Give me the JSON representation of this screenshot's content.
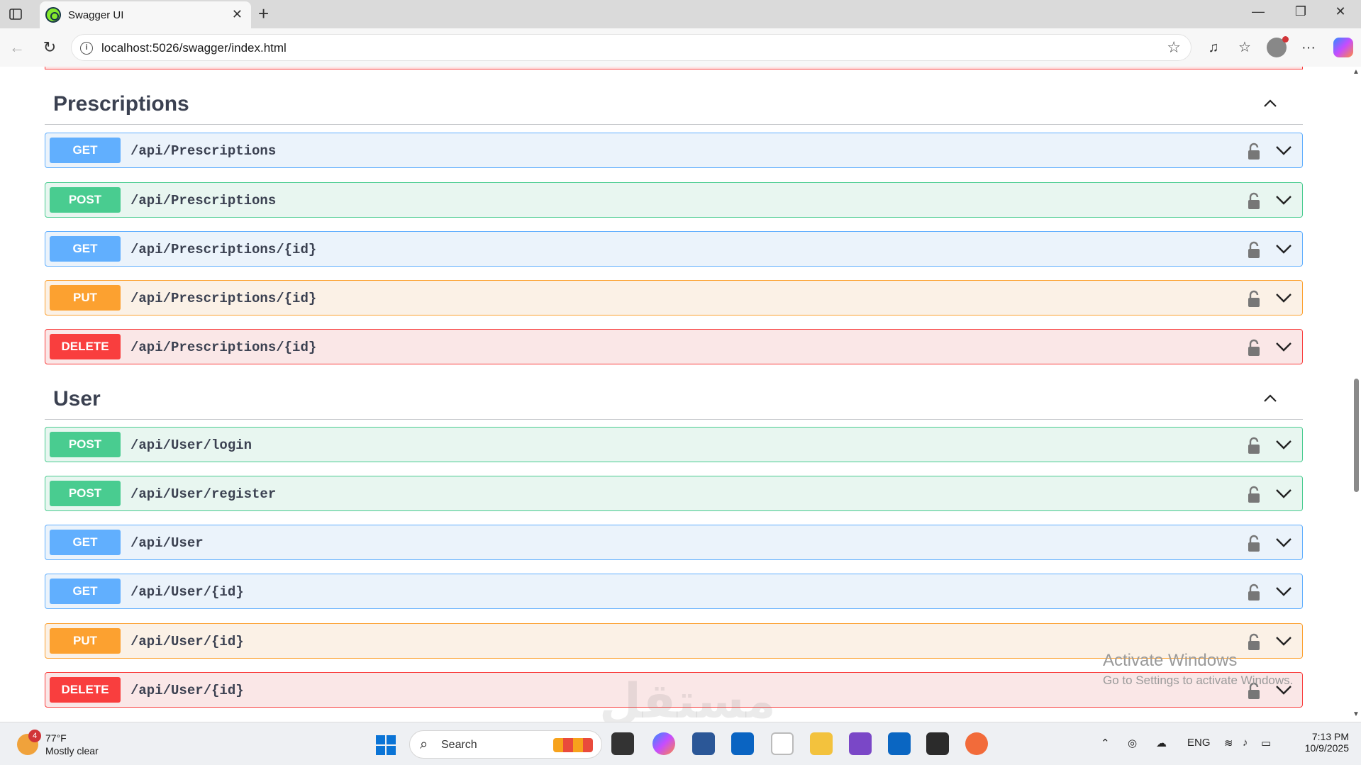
{
  "browser": {
    "tab_title": "Swagger UI",
    "url": "localhost:5026/swagger/index.html"
  },
  "sections": [
    {
      "title": "Prescriptions",
      "operations": [
        {
          "method": "GET",
          "path": "/api/Prescriptions"
        },
        {
          "method": "POST",
          "path": "/api/Prescriptions"
        },
        {
          "method": "GET",
          "path": "/api/Prescriptions/{id}"
        },
        {
          "method": "PUT",
          "path": "/api/Prescriptions/{id}"
        },
        {
          "method": "DELETE",
          "path": "/api/Prescriptions/{id}"
        }
      ]
    },
    {
      "title": "User",
      "operations": [
        {
          "method": "POST",
          "path": "/api/User/login"
        },
        {
          "method": "POST",
          "path": "/api/User/register"
        },
        {
          "method": "GET",
          "path": "/api/User"
        },
        {
          "method": "GET",
          "path": "/api/User/{id}"
        },
        {
          "method": "PUT",
          "path": "/api/User/{id}"
        },
        {
          "method": "DELETE",
          "path": "/api/User/{id}"
        }
      ]
    }
  ],
  "colors": {
    "get": "#61affe",
    "post": "#49cc90",
    "put": "#fca130",
    "delete": "#f93e3e"
  },
  "watermark": {
    "line1": "Activate Windows",
    "line2": "Go to Settings to activate Windows.",
    "logo_text": "مستقل"
  },
  "taskbar": {
    "weather_badge": "4",
    "weather_temp": "77°F",
    "weather_condition": "Mostly clear",
    "search_label": "Search",
    "language": "ENG",
    "time": "7:13 PM",
    "date": "10/9/2025"
  }
}
